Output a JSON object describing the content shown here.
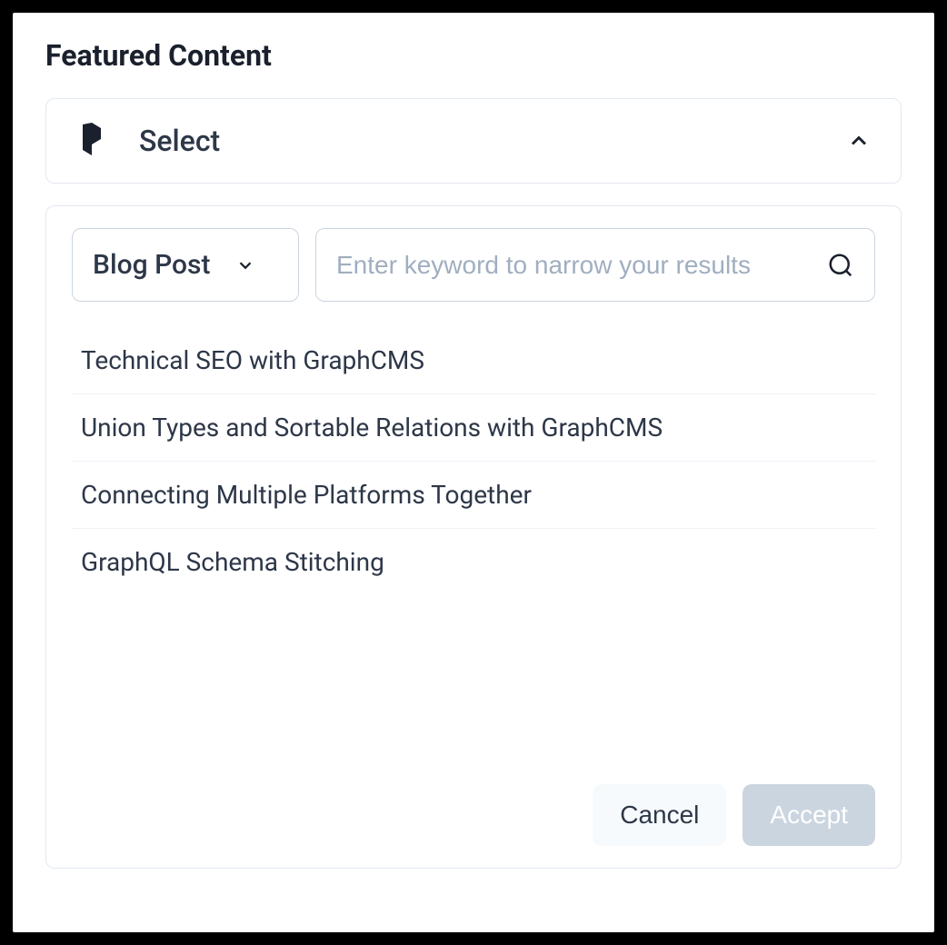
{
  "page_title": "Featured Content",
  "select_header": {
    "label": "Select"
  },
  "filter": {
    "content_type": "Blog Post",
    "search_placeholder": "Enter keyword to narrow your results"
  },
  "results": [
    "Technical SEO with GraphCMS",
    "Union Types and Sortable Relations with GraphCMS",
    "Connecting Multiple Platforms Together",
    "GraphQL Schema Stitching"
  ],
  "actions": {
    "cancel": "Cancel",
    "accept": "Accept"
  }
}
